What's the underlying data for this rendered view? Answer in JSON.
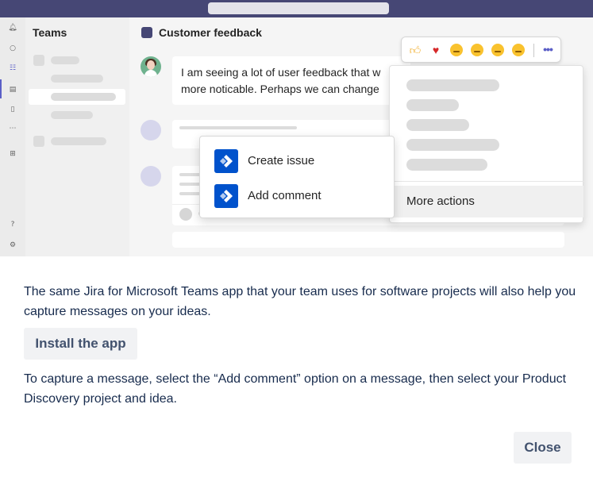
{
  "illustration": {
    "teams_panel": {
      "title": "Teams"
    },
    "channel": {
      "title": "Customer feedback"
    },
    "message": {
      "line1": "I am seeing a lot of user feedback that w",
      "line2": "more noticable. Perhaps we can change"
    },
    "reactions": [
      "thumbs-up",
      "heart",
      "laughing",
      "surprised",
      "sad",
      "angry"
    ],
    "more_menu": {
      "more_actions_label": "More actions"
    },
    "jira_menu": {
      "items": [
        {
          "label": "Create issue"
        },
        {
          "label": "Add comment"
        }
      ]
    },
    "colors": {
      "teams_purple": "#464775",
      "teams_accent": "#5b5fc7",
      "jira_blue": "#0052cc"
    }
  },
  "dialog": {
    "description": "The same Jira for Microsoft Teams app that your team uses for software projects will also help you capture messages on your ideas.",
    "install_button_label": "Install the app",
    "instructions": "To capture a message, select the “Add comment” option on a message, then select your Product Discovery project and idea.",
    "close_button_label": "Close"
  }
}
